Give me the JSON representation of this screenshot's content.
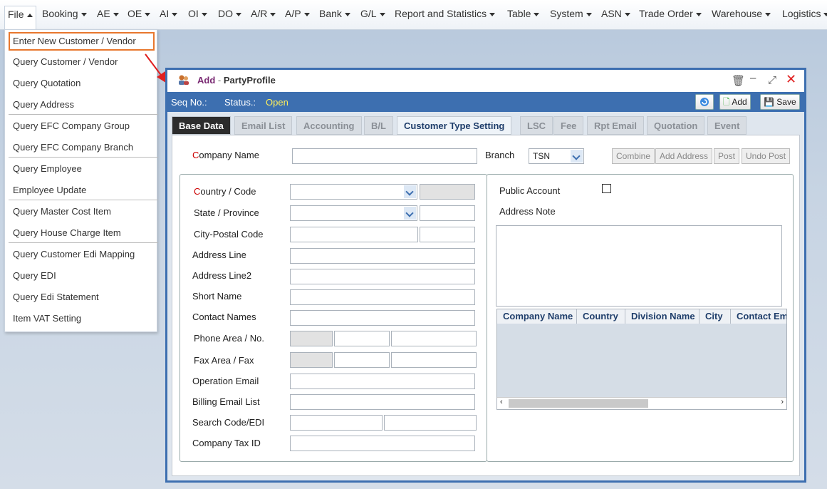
{
  "menu": [
    {
      "label": "File",
      "active": true
    },
    {
      "label": "Booking"
    },
    {
      "label": "AE"
    },
    {
      "label": "OE"
    },
    {
      "label": "AI"
    },
    {
      "label": "OI"
    },
    {
      "label": "DO"
    },
    {
      "label": "A/R"
    },
    {
      "label": "A/P"
    },
    {
      "label": "Bank"
    },
    {
      "label": "G/L"
    },
    {
      "label": "Report and Statistics"
    },
    {
      "label": "Table"
    },
    {
      "label": "System"
    },
    {
      "label": "ASN"
    },
    {
      "label": "Trade Order"
    },
    {
      "label": "Warehouse"
    },
    {
      "label": "Logistics"
    }
  ],
  "file_menu": [
    "Enter New Customer / Vendor",
    "Query Customer / Vendor",
    "Query Quotation",
    "Query Address",
    "Query EFC Company Group",
    "Query EFC Company Branch",
    "Query Employee",
    "Employee Update",
    "Query Master Cost Item",
    "Query House Charge Item",
    "Query Customer Edi Mapping",
    "Query EDI",
    "Query Edi Statement",
    "Item VAT Setting"
  ],
  "window": {
    "title_mode": "Add",
    "title_sep": " - ",
    "title_name": "PartyProfile",
    "seq_label": "Seq No.:",
    "status_label": "Status.:",
    "status_value": "Open",
    "add_label": "Add",
    "save_label": "Save"
  },
  "tabs": [
    "Base Data",
    "Email List",
    "Accounting",
    "B/L",
    "Customer Type Setting",
    "LSC",
    "Fee",
    "Rpt Email",
    "Quotation",
    "Event"
  ],
  "form": {
    "company_name_first": "C",
    "company_name_rest": "ompany Name",
    "branch_label": "Branch",
    "branch_value": "TSN",
    "combine": "Combine",
    "add_address": "Add Address",
    "post": "Post",
    "undo_post": "Undo Post",
    "country_first": "C",
    "country_rest": "ountry / Code",
    "state": "State / Province",
    "city": "City-Postal Code",
    "address1": "Address Line",
    "address2": "Address Line2",
    "short_name": "Short Name",
    "contact": "Contact Names",
    "phone": "Phone Area / No.",
    "fax": "Fax Area / Fax",
    "op_email": "Operation Email",
    "billing_email": "Billing Email List",
    "search_code": "Search Code/EDI",
    "tax_id": "Company Tax ID",
    "public_account": "Public Account",
    "address_note": "Address Note"
  },
  "grid_columns": [
    "Company Name",
    "Country",
    "Division Name",
    "City",
    "Contact Em"
  ],
  "colors": {
    "window_border": "#3d6fb0",
    "status_value": "#ffef5b",
    "highlight": "#e8772d"
  }
}
